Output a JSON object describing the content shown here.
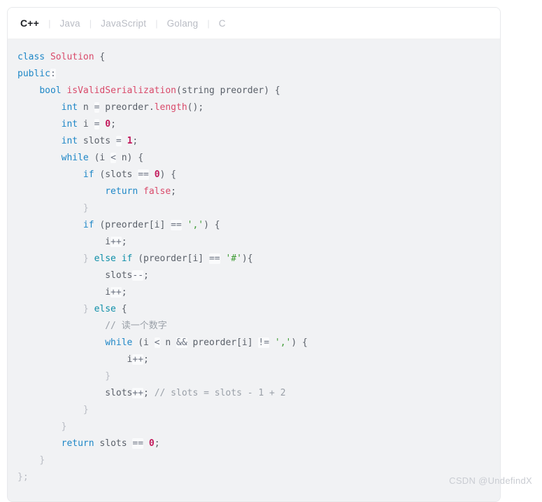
{
  "card": {
    "tabs": [
      {
        "label": "C++",
        "active": true
      },
      {
        "label": "Java",
        "active": false
      },
      {
        "label": "JavaScript",
        "active": false
      },
      {
        "label": "Golang",
        "active": false
      },
      {
        "label": "C",
        "active": false
      }
    ],
    "separator": "|"
  },
  "code": {
    "language": "C++",
    "lines": [
      [
        {
          "t": "class",
          "c": "kw"
        },
        {
          "t": " ",
          "c": "pl"
        },
        {
          "t": "Solution",
          "c": "typ"
        },
        {
          "t": " {",
          "c": "pl"
        }
      ],
      [
        {
          "t": "public",
          "c": "kw"
        },
        {
          "t": ":",
          "c": "op"
        }
      ],
      [
        {
          "t": "    ",
          "c": "pl"
        },
        {
          "t": "bool",
          "c": "kw"
        },
        {
          "t": " ",
          "c": "pl"
        },
        {
          "t": "isValidSerialization",
          "c": "typ"
        },
        {
          "t": "(string preorder) {",
          "c": "pl"
        }
      ],
      [
        {
          "t": "        ",
          "c": "pl"
        },
        {
          "t": "int",
          "c": "kw"
        },
        {
          "t": " n ",
          "c": "pl"
        },
        {
          "t": "=",
          "c": "op"
        },
        {
          "t": " preorder.",
          "c": "pl"
        },
        {
          "t": "length",
          "c": "typ"
        },
        {
          "t": "();",
          "c": "pl"
        }
      ],
      [
        {
          "t": "        ",
          "c": "pl"
        },
        {
          "t": "int",
          "c": "kw"
        },
        {
          "t": " i ",
          "c": "pl"
        },
        {
          "t": "=",
          "c": "op"
        },
        {
          "t": " ",
          "c": "pl"
        },
        {
          "t": "0",
          "c": "num"
        },
        {
          "t": ";",
          "c": "pl"
        }
      ],
      [
        {
          "t": "        ",
          "c": "pl"
        },
        {
          "t": "int",
          "c": "kw"
        },
        {
          "t": " slots ",
          "c": "pl"
        },
        {
          "t": "=",
          "c": "op"
        },
        {
          "t": " ",
          "c": "pl"
        },
        {
          "t": "1",
          "c": "num"
        },
        {
          "t": ";",
          "c": "pl"
        }
      ],
      [
        {
          "t": "        ",
          "c": "pl"
        },
        {
          "t": "while",
          "c": "kw"
        },
        {
          "t": " (i ",
          "c": "pl"
        },
        {
          "t": "<",
          "c": "op"
        },
        {
          "t": " n) {",
          "c": "pl"
        }
      ],
      [
        {
          "t": "            ",
          "c": "pl"
        },
        {
          "t": "if",
          "c": "kw"
        },
        {
          "t": " (slots ",
          "c": "pl"
        },
        {
          "t": "==",
          "c": "op"
        },
        {
          "t": " ",
          "c": "pl"
        },
        {
          "t": "0",
          "c": "num"
        },
        {
          "t": ") {",
          "c": "pl"
        }
      ],
      [
        {
          "t": "                ",
          "c": "pl"
        },
        {
          "t": "return",
          "c": "kw"
        },
        {
          "t": " ",
          "c": "pl"
        },
        {
          "t": "false",
          "c": "typ"
        },
        {
          "t": ";",
          "c": "pl"
        }
      ],
      [
        {
          "t": "            ",
          "c": "pl"
        },
        {
          "t": "}",
          "c": "pun"
        }
      ],
      [
        {
          "t": "            ",
          "c": "pl"
        },
        {
          "t": "if",
          "c": "kw"
        },
        {
          "t": " (preorder[i] ",
          "c": "pl"
        },
        {
          "t": "==",
          "c": "op"
        },
        {
          "t": " ",
          "c": "pl"
        },
        {
          "t": "','",
          "c": "str"
        },
        {
          "t": ") {",
          "c": "pl"
        }
      ],
      [
        {
          "t": "                ",
          "c": "pl"
        },
        {
          "t": "i",
          "c": "pl"
        },
        {
          "t": "++",
          "c": "op"
        },
        {
          "t": ";",
          "c": "pl"
        }
      ],
      [
        {
          "t": "            ",
          "c": "pl"
        },
        {
          "t": "}",
          "c": "pun"
        },
        {
          "t": " ",
          "c": "pl"
        },
        {
          "t": "else",
          "c": "kw2"
        },
        {
          "t": " ",
          "c": "pl"
        },
        {
          "t": "if",
          "c": "kw2"
        },
        {
          "t": " (preorder[i] ",
          "c": "pl"
        },
        {
          "t": "==",
          "c": "op"
        },
        {
          "t": " ",
          "c": "pl"
        },
        {
          "t": "'#'",
          "c": "str"
        },
        {
          "t": "){",
          "c": "pl"
        }
      ],
      [
        {
          "t": "                ",
          "c": "pl"
        },
        {
          "t": "slots",
          "c": "pl"
        },
        {
          "t": "--",
          "c": "op"
        },
        {
          "t": ";",
          "c": "pl"
        }
      ],
      [
        {
          "t": "                ",
          "c": "pl"
        },
        {
          "t": "i",
          "c": "pl"
        },
        {
          "t": "++",
          "c": "op"
        },
        {
          "t": ";",
          "c": "pl"
        }
      ],
      [
        {
          "t": "            ",
          "c": "pl"
        },
        {
          "t": "}",
          "c": "pun"
        },
        {
          "t": " ",
          "c": "pl"
        },
        {
          "t": "else",
          "c": "kw2"
        },
        {
          "t": " {",
          "c": "pl"
        }
      ],
      [
        {
          "t": "                ",
          "c": "pl"
        },
        {
          "t": "// 读一个数字",
          "c": "cmt"
        }
      ],
      [
        {
          "t": "                ",
          "c": "pl"
        },
        {
          "t": "while",
          "c": "kw"
        },
        {
          "t": " (i ",
          "c": "pl"
        },
        {
          "t": "<",
          "c": "op"
        },
        {
          "t": " n ",
          "c": "pl"
        },
        {
          "t": "&&",
          "c": "op"
        },
        {
          "t": " preorder[i] ",
          "c": "pl"
        },
        {
          "t": "!=",
          "c": "op"
        },
        {
          "t": " ",
          "c": "pl"
        },
        {
          "t": "','",
          "c": "str"
        },
        {
          "t": ") {",
          "c": "pl"
        }
      ],
      [
        {
          "t": "                    ",
          "c": "pl"
        },
        {
          "t": "i",
          "c": "pl"
        },
        {
          "t": "++",
          "c": "op"
        },
        {
          "t": ";",
          "c": "pl"
        }
      ],
      [
        {
          "t": "                ",
          "c": "pl"
        },
        {
          "t": "}",
          "c": "pun"
        }
      ],
      [
        {
          "t": "                ",
          "c": "pl"
        },
        {
          "t": "slots",
          "c": "pl"
        },
        {
          "t": "++",
          "c": "op"
        },
        {
          "t": "; ",
          "c": "pl"
        },
        {
          "t": "// slots = slots - 1 + 2",
          "c": "cmt"
        }
      ],
      [
        {
          "t": "            ",
          "c": "pl"
        },
        {
          "t": "}",
          "c": "pun"
        }
      ],
      [
        {
          "t": "        ",
          "c": "pl"
        },
        {
          "t": "}",
          "c": "pun"
        }
      ],
      [
        {
          "t": "        ",
          "c": "pl"
        },
        {
          "t": "return",
          "c": "kw"
        },
        {
          "t": " slots ",
          "c": "pl"
        },
        {
          "t": "==",
          "c": "op"
        },
        {
          "t": " ",
          "c": "pl"
        },
        {
          "t": "0",
          "c": "num"
        },
        {
          "t": ";",
          "c": "pl"
        }
      ],
      [
        {
          "t": "    ",
          "c": "pl"
        },
        {
          "t": "}",
          "c": "pun"
        }
      ],
      [
        {
          "t": "};",
          "c": "pun"
        }
      ]
    ]
  },
  "watermark": {
    "text": "CSDN @UndefindX"
  }
}
